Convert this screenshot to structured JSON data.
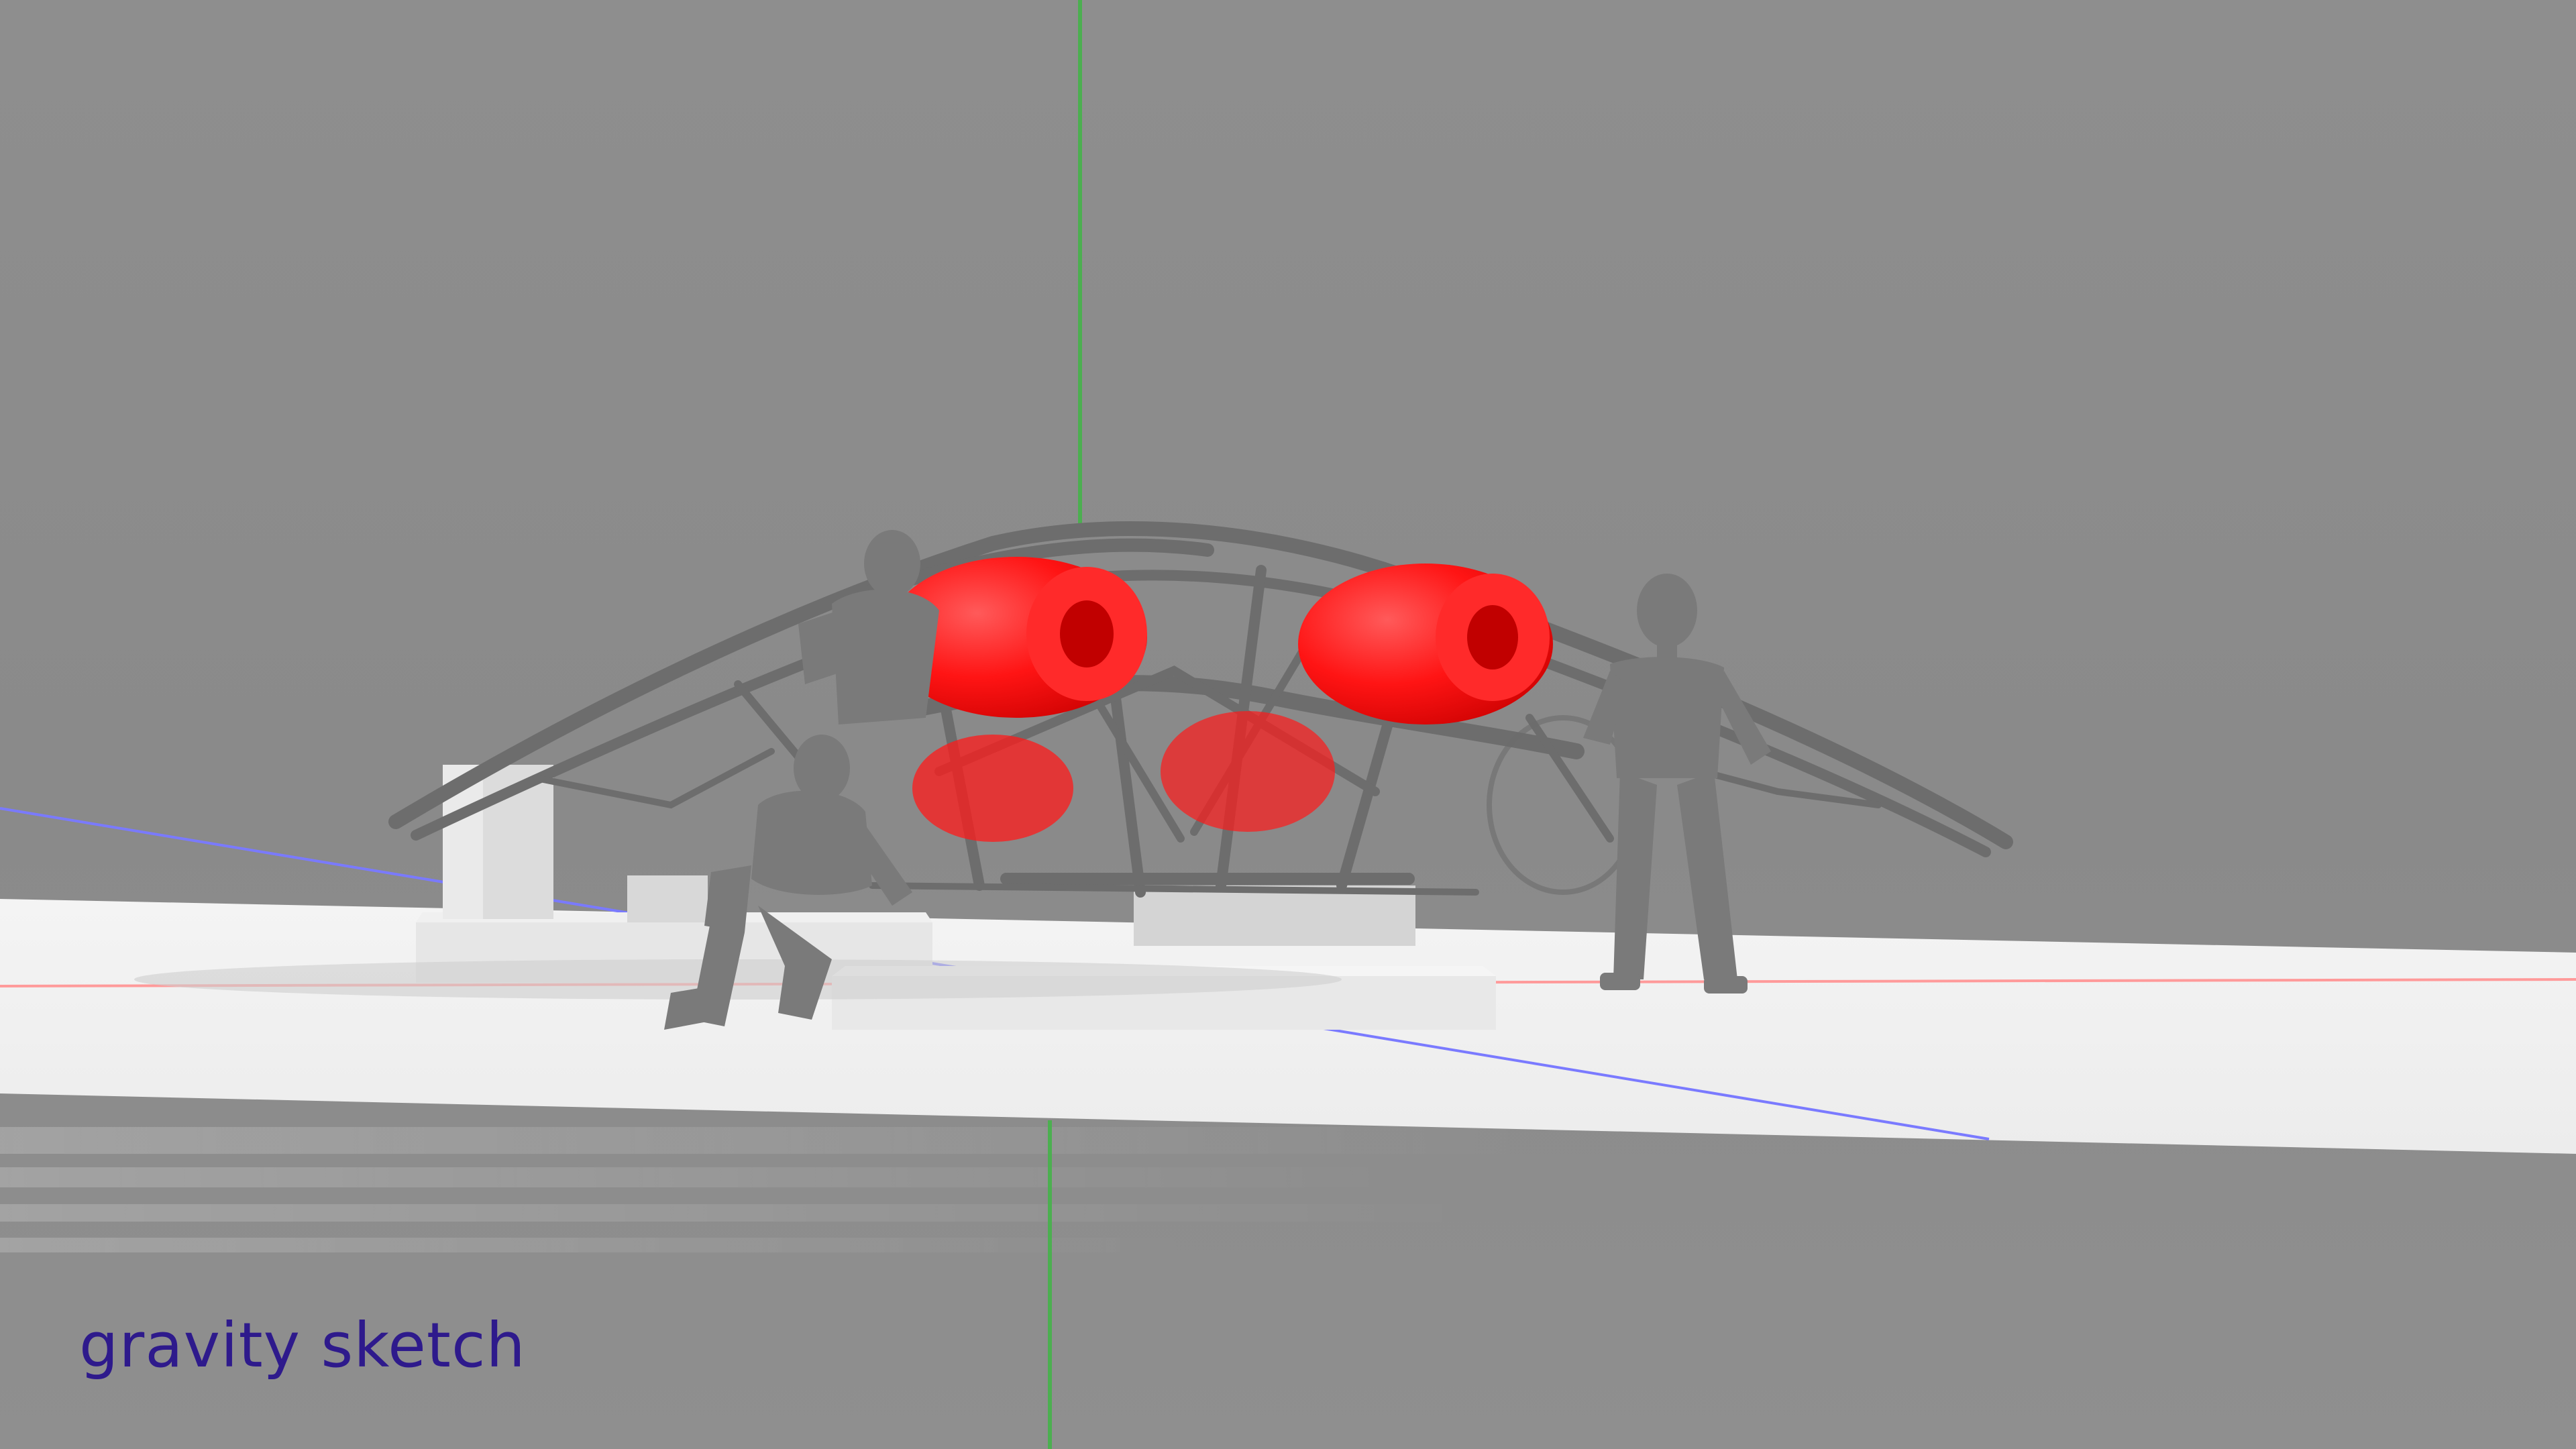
{
  "app": {
    "logo_text": "gravity sketch"
  },
  "viewport": {
    "background_color": "#8c8c8c",
    "floor_color": "#f2f2f2",
    "axis_colors": {
      "x": "#ff9a9a",
      "y": "#4caf50",
      "z": "#7a7aff"
    },
    "model": {
      "accent_color": "#ff1a1a",
      "frame_color": "#6d6d6d",
      "figure_color": "#7a7a7a"
    }
  },
  "brand": {
    "logo_color": "#2e1a8c"
  },
  "icons": {
    "logo": "gravity-sketch-wordmark"
  }
}
